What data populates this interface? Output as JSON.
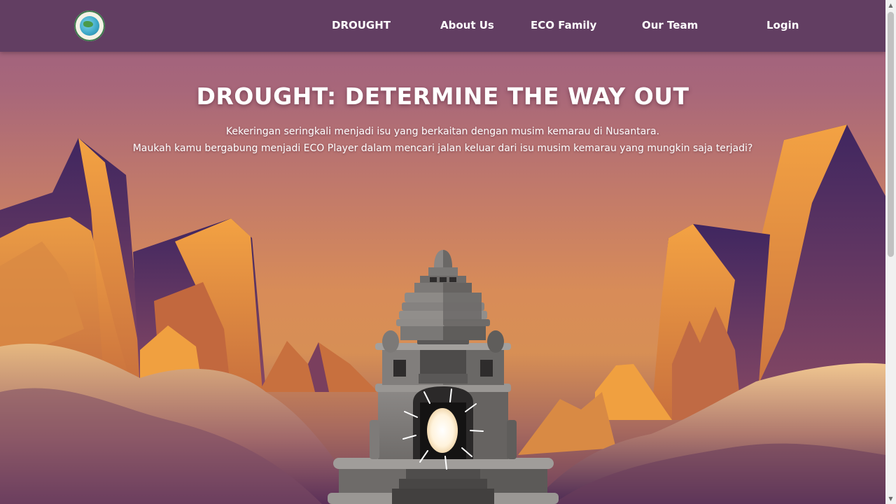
{
  "nav": {
    "logo_alt": "ECO logo",
    "links": [
      "DROUGHT",
      "About Us",
      "ECO Family",
      "Our Team",
      "Login"
    ]
  },
  "hero": {
    "title": "DROUGHT: DETERMINE THE WAY OUT",
    "desc_line1": "Kekeringan seringkali menjadi isu yang berkaitan dengan musim kemarau di Nusantara.",
    "desc_line2": "Maukah kamu bergabung menjadi ECO Player dalam mencari jalan keluar dari isu musim kemarau yang mungkin saja terjadi?"
  },
  "colors": {
    "navbar": "#623e62",
    "mountain_orange": "#f0a040",
    "mountain_purple": "#4a2a5e",
    "temple_grey": "#7a7876",
    "glow": "#fff6e8"
  }
}
